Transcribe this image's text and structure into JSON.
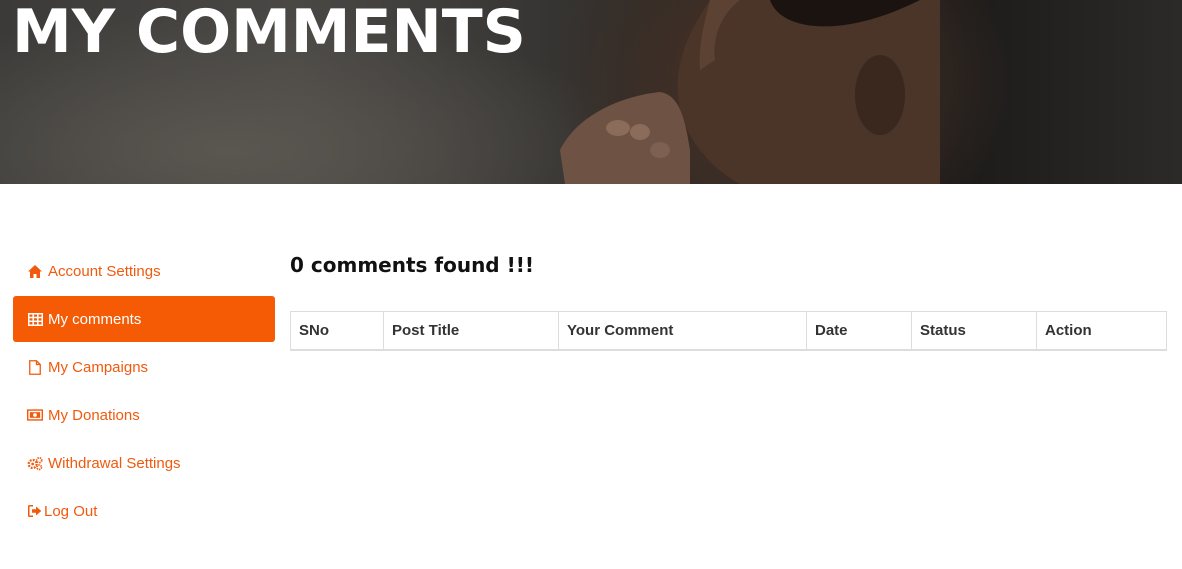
{
  "hero": {
    "title": "MY COMMENTS"
  },
  "sidebar": {
    "items": [
      {
        "label": "Account Settings",
        "icon": "home-icon",
        "active": false
      },
      {
        "label": "My comments",
        "icon": "table-icon",
        "active": true
      },
      {
        "label": "My Campaigns",
        "icon": "file-icon",
        "active": false
      },
      {
        "label": "My Donations",
        "icon": "money-icon",
        "active": false
      },
      {
        "label": "Withdrawal Settings",
        "icon": "gears-icon",
        "active": false
      },
      {
        "label": "Log Out",
        "icon": "sign-out-icon",
        "active": false
      }
    ]
  },
  "main": {
    "heading": "0 comments found !!!",
    "table": {
      "columns": [
        "SNo",
        "Post Title",
        "Your Comment",
        "Date",
        "Status",
        "Action"
      ],
      "rows": []
    }
  },
  "colors": {
    "accent": "#f55a05",
    "text": "#333333"
  }
}
